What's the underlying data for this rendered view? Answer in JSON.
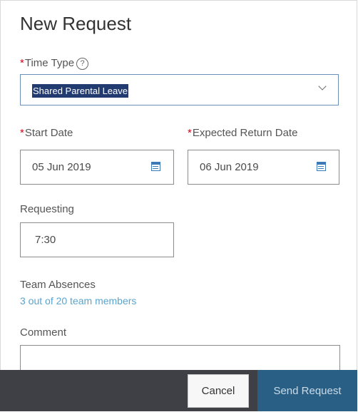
{
  "dialog": {
    "title": "New Request"
  },
  "time_type": {
    "required_mark": "*",
    "label": "Time Type",
    "help_icon": "help-circle-icon",
    "help_glyph": "?",
    "value": "Shared Parental Leave",
    "dropdown_icon": "chevron-down-icon"
  },
  "start_date": {
    "required_mark": "*",
    "label": "Start Date",
    "value": "05 Jun 2019",
    "icon": "calendar-icon"
  },
  "return_date": {
    "required_mark": "*",
    "label": "Expected Return Date",
    "value": "06 Jun 2019",
    "icon": "calendar-icon"
  },
  "requesting": {
    "label": "Requesting",
    "value": "7:30"
  },
  "team_absences": {
    "label": "Team Absences",
    "link_text": "3 out of 20 team members"
  },
  "comment": {
    "label": "Comment",
    "value": ""
  },
  "footer": {
    "cancel_label": "Cancel",
    "send_label": "Send Request"
  },
  "colors": {
    "required": "#d0021b",
    "link": "#5aa5cf",
    "selection": "#213a70",
    "footer_bg": "#3e4046",
    "primary_button": "#2a5f85",
    "calendar_icon": "#3d7ab8"
  }
}
